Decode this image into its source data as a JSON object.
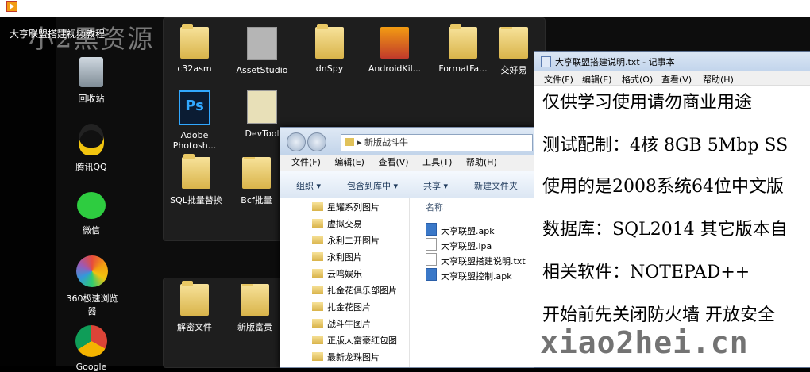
{
  "video": {
    "title": "大亨联盟搭建视频教程",
    "watermark": "小2黑资源"
  },
  "desktop_left": [
    {
      "label": "回收站",
      "icon": "recycle-bin-icon"
    },
    {
      "label": "腾讯QQ",
      "icon": "qq-icon"
    },
    {
      "label": "微信",
      "icon": "wechat-icon"
    },
    {
      "label": "360极速浏览器",
      "icon": "browser-360-icon"
    },
    {
      "label": "Google",
      "icon": "chrome-icon"
    }
  ],
  "desktop_grid": [
    {
      "label": "c32asm"
    },
    {
      "label": "AssetStudio"
    },
    {
      "label": "dnSpy"
    },
    {
      "label": "AndroidKil..."
    },
    {
      "label": "FormatFa..."
    },
    {
      "label": "交好易"
    },
    {
      "label": "Adobe Photosh..."
    },
    {
      "label": "DevTool"
    },
    {
      "label": "SQL批量替换"
    },
    {
      "label": "Bcf批量"
    },
    {
      "label": "解密文件"
    },
    {
      "label": "新版富贵"
    }
  ],
  "explorer": {
    "address": "新版战斗牛",
    "menu": [
      "文件(F)",
      "编辑(E)",
      "查看(V)",
      "工具(T)",
      "帮助(H)"
    ],
    "toolbar": [
      "组织 ▾",
      "包含到库中 ▾",
      "共享 ▾",
      "新建文件夹"
    ],
    "nav_folders": [
      "星耀系列图片",
      "虚拟交易",
      "永利二开图片",
      "永利图片",
      "云鸣娱乐",
      "扎金花俱乐部图片",
      "扎金花图片",
      "战斗牛图片",
      "正版大富豪红包图",
      "最新龙珠图片"
    ],
    "column_name": "名称",
    "files": [
      {
        "name": "大亨联盟.apk",
        "type": "apk"
      },
      {
        "name": "大亨联盟.ipa",
        "type": "doc"
      },
      {
        "name": "大亨联盟搭建说明.txt",
        "type": "txt"
      },
      {
        "name": "大亨联盟控制.apk",
        "type": "apk"
      }
    ]
  },
  "notepad": {
    "title": "大亨联盟搭建说明.txt - 记事本",
    "menu": [
      "文件(F)",
      "编辑(E)",
      "格式(O)",
      "查看(V)",
      "帮助(H)"
    ],
    "lines": [
      "仅供学习使用请勿商业用途 ",
      "测试配制：4核 8GB 5Mbp SS",
      "使用的是2008系统64位中文版",
      "数据库：SQL2014 其它版本自",
      "相关软件：NOTEPAD++",
      "开始前先关闭防火墙 开放安全"
    ]
  },
  "watermark_url": "xiao2hei.cn"
}
